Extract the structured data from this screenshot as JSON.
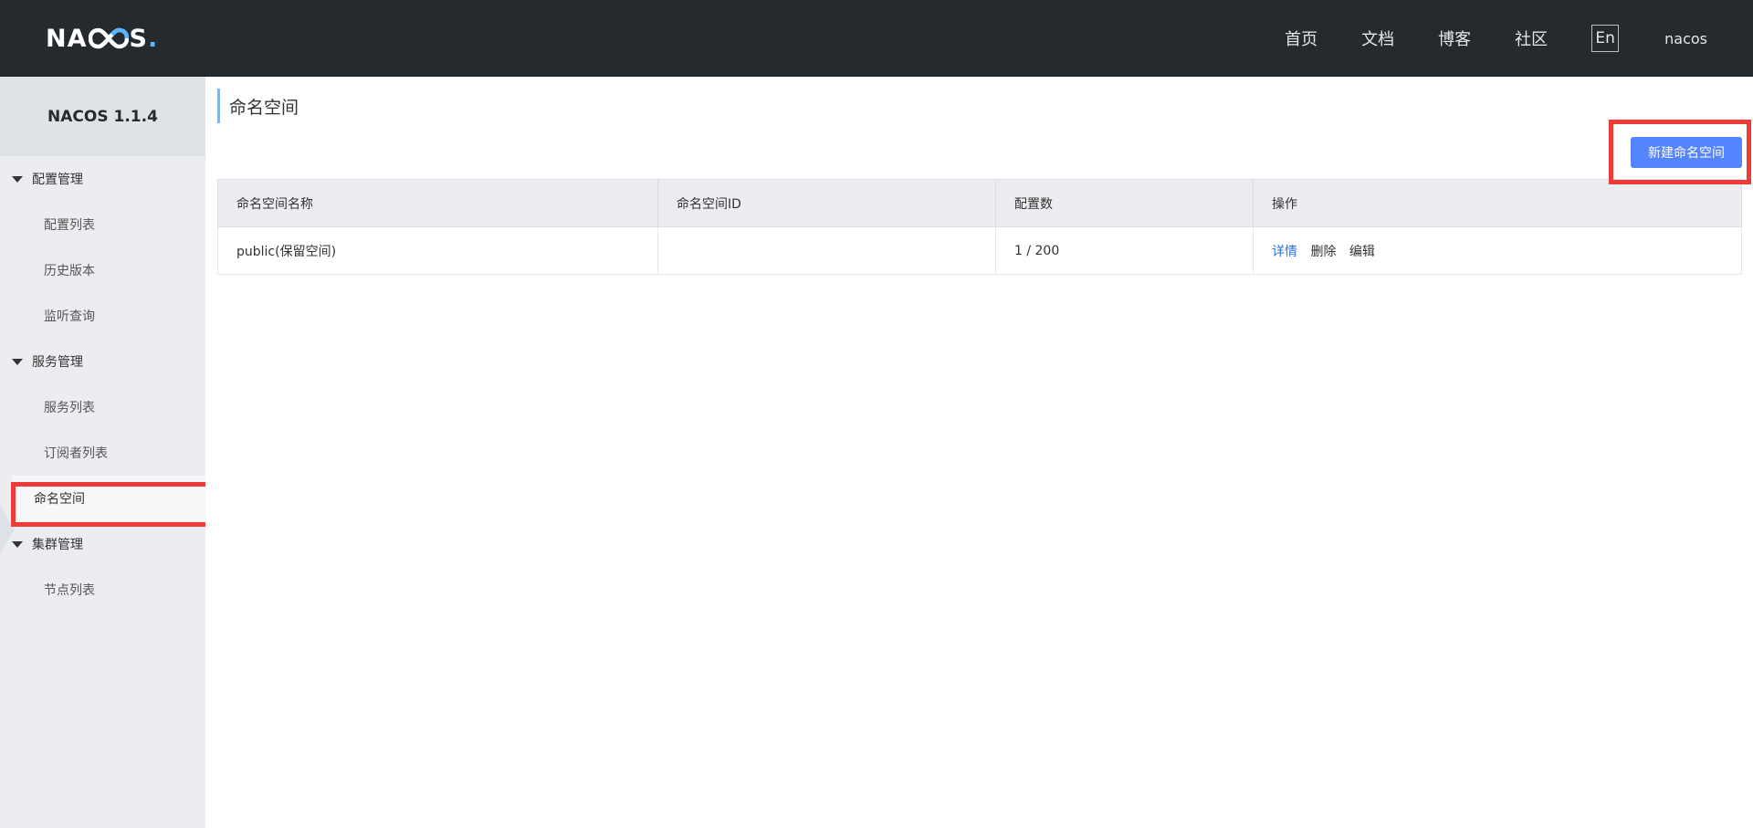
{
  "header": {
    "logo_left": "NA",
    "logo_right": "S",
    "logo_dot": ".",
    "nav": [
      "首页",
      "文档",
      "博客",
      "社区"
    ],
    "lang": "En",
    "user": "nacos"
  },
  "sidebar": {
    "title": "NACOS 1.1.4",
    "groups": [
      {
        "label": "配置管理",
        "items": [
          "配置列表",
          "历史版本",
          "监听查询"
        ]
      },
      {
        "label": "服务管理",
        "items": [
          "服务列表",
          "订阅者列表"
        ]
      },
      {
        "label": "集群管理",
        "items": [
          "节点列表"
        ]
      }
    ],
    "standalone": "命名空间"
  },
  "main": {
    "title": "命名空间",
    "create_button": "新建命名空间",
    "table": {
      "headers": [
        "命名空间名称",
        "命名空间ID",
        "配置数",
        "操作"
      ],
      "rows": [
        {
          "name": "public(保留空间)",
          "id": "",
          "config_count": "1 / 200",
          "ops": [
            "详情",
            "删除",
            "编辑"
          ]
        }
      ]
    }
  },
  "colors": {
    "header_bg": "#252a2f",
    "sidebar_bg": "#ebedf0",
    "primary_button": "#5584ff",
    "link": "#2e6fd8",
    "highlight": "#ef3a3a"
  }
}
